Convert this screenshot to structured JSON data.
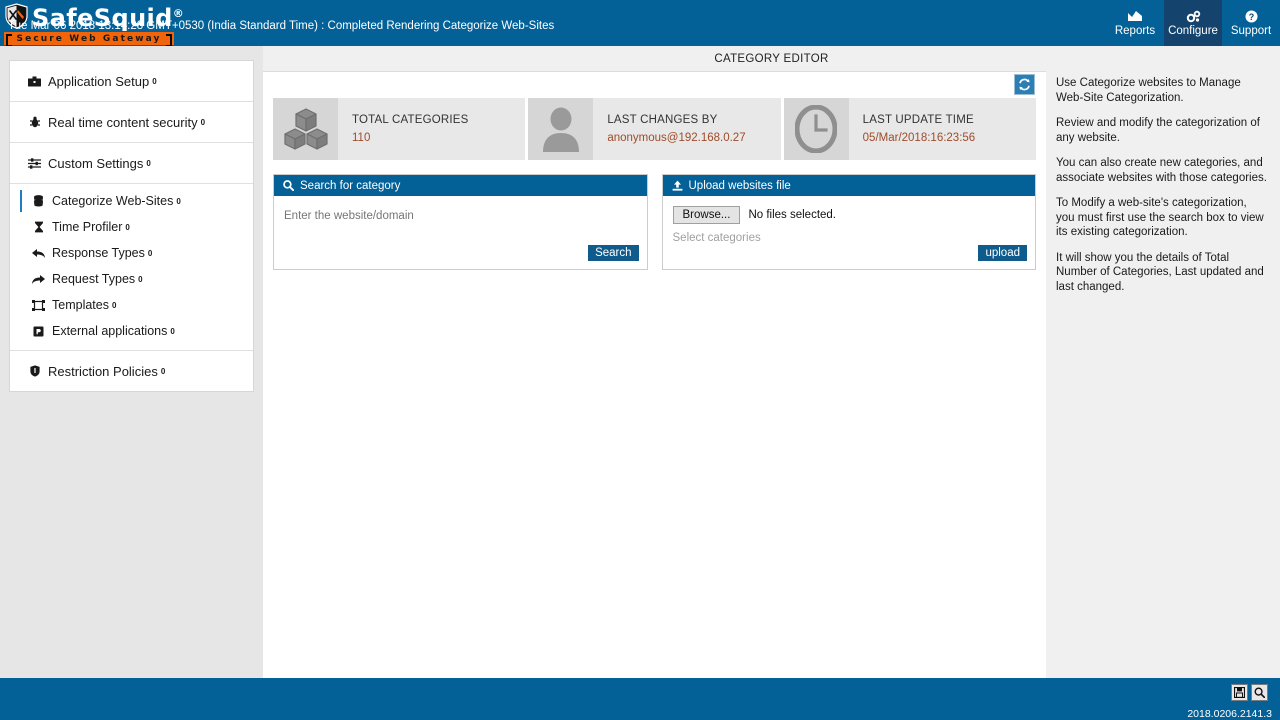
{
  "brand": {
    "name": "SafeSquid",
    "registered": "®",
    "tagline": "Secure Web Gateway",
    "shield_icon": "shield-tools-icon"
  },
  "colors": {
    "header_blue": "#036198",
    "active_nav": "#14446e",
    "accent_orange": "#f2640a",
    "value_brown": "#9e4c2a",
    "panel_header": "#036198",
    "sidebar_active_bar": "#1c7fc0"
  },
  "nav": {
    "items": [
      {
        "label": "Reports",
        "icon": "chart-icon",
        "active": false
      },
      {
        "label": "Configure",
        "icon": "gears-icon",
        "active": true
      },
      {
        "label": "Support",
        "icon": "help-circle-icon",
        "active": false
      }
    ]
  },
  "page": {
    "title": "CATEGORY EDITOR",
    "refresh_icon": "refresh-icon"
  },
  "sidebar": {
    "groups": [
      {
        "items": [
          {
            "label": "Application Setup",
            "badge": "0",
            "icon": "briefcase-icon",
            "level": "top",
            "active": false
          }
        ]
      },
      {
        "items": [
          {
            "label": "Real time content security",
            "badge": "0",
            "icon": "bug-icon",
            "level": "top",
            "active": false
          }
        ]
      },
      {
        "items": [
          {
            "label": "Custom Settings",
            "badge": "0",
            "icon": "sliders-icon",
            "level": "top",
            "active": false
          }
        ]
      },
      {
        "items": [
          {
            "label": "Categorize Web-Sites",
            "badge": "0",
            "icon": "database-icon",
            "level": "sub",
            "active": true
          },
          {
            "label": "Time Profiler",
            "badge": "0",
            "icon": "hourglass-icon",
            "level": "sub",
            "active": false
          },
          {
            "label": "Response Types",
            "badge": "0",
            "icon": "reply-icon",
            "level": "sub",
            "active": false
          },
          {
            "label": "Request Types",
            "badge": "0",
            "icon": "share-icon",
            "level": "sub",
            "active": false
          },
          {
            "label": "Templates",
            "badge": "0",
            "icon": "template-icon",
            "level": "sub",
            "active": false
          },
          {
            "label": "External applications",
            "badge": "0",
            "icon": "external-app-icon",
            "level": "sub",
            "active": false
          }
        ]
      },
      {
        "items": [
          {
            "label": "Restriction Policies",
            "badge": "0",
            "icon": "shield-icon",
            "level": "top",
            "active": false
          }
        ]
      }
    ]
  },
  "cards": [
    {
      "title": "TOTAL CATEGORIES",
      "value": "110",
      "icon": "cubes-icon"
    },
    {
      "title": "LAST CHANGES BY",
      "value": "anonymous@192.168.0.27",
      "icon": "user-icon"
    },
    {
      "title": "LAST UPDATE TIME",
      "value": "05/Mar/2018:16:23:56",
      "icon": "clock-icon"
    }
  ],
  "search_panel": {
    "header": "Search for category",
    "header_icon": "search-icon",
    "placeholder": "Enter the website/domain",
    "value": "",
    "button": "Search"
  },
  "upload_panel": {
    "header": "Upload websites file",
    "header_icon": "upload-icon",
    "browse_button": "Browse...",
    "file_status": "No files selected.",
    "select_categories_placeholder": "Select categories",
    "button": "upload"
  },
  "help": {
    "paragraphs": [
      "Use Categorize websites to Manage Web-Site Categorization.",
      "Review and modify the categorization of any website.",
      "You can also create new categories, and associate websites with those categories.",
      "To Modify a web-site's categorization, you must first use the search box to view its existing categorization.",
      "It will show you the details of Total Number of Categories, Last updated and last changed."
    ]
  },
  "footer": {
    "message": "Tue Mar 06 2018 13:14:28 GMT+0530 (India Standard Time) : Completed Rendering Categorize Web-Sites",
    "version": "2018.0206.2141.3",
    "buttons": [
      {
        "name": "save-icon",
        "label": "save"
      },
      {
        "name": "search-icon",
        "label": "search"
      }
    ]
  }
}
